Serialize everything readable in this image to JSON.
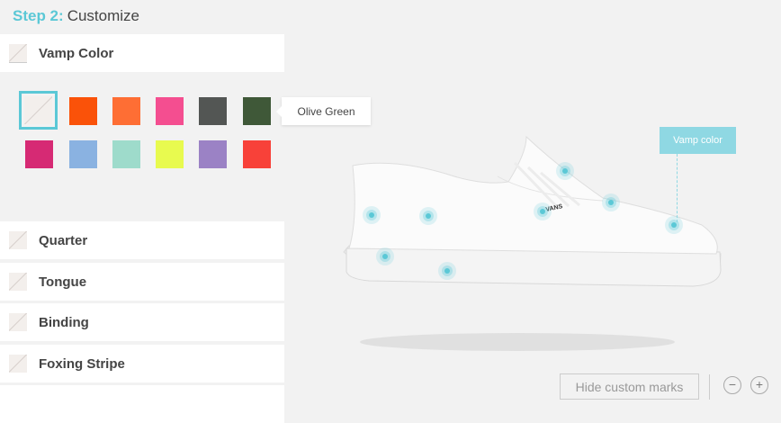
{
  "step": {
    "number": "Step 2:",
    "title": "Customize"
  },
  "vamp": {
    "label": "Vamp Color",
    "tooltip": "Olive Green",
    "swatches": [
      {
        "color": "none"
      },
      {
        "color": "#fa5209"
      },
      {
        "color": "#fe6e34"
      },
      {
        "color": "#f44e90"
      },
      {
        "color": "#535654"
      },
      {
        "color": "#3f5838"
      },
      {
        "color": "#d62a74"
      },
      {
        "color": "#8ab2e1"
      },
      {
        "color": "#9edbcb"
      },
      {
        "color": "#e8fa4f"
      },
      {
        "color": "#9b82c5"
      },
      {
        "color": "#f84139"
      }
    ]
  },
  "parts": [
    {
      "label": "Quarter"
    },
    {
      "label": "Tongue"
    },
    {
      "label": "Binding"
    },
    {
      "label": "Foxing Stripe"
    }
  ],
  "callout": {
    "label": "Vamp color"
  },
  "controls": {
    "hide_marks": "Hide custom marks",
    "zoom_out": "−",
    "zoom_in": "+"
  },
  "shoe": {
    "brand_mark": "VANS"
  }
}
